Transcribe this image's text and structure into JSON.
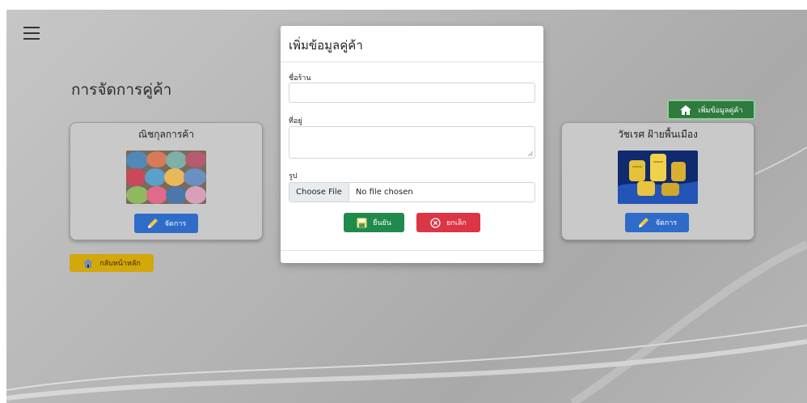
{
  "header": {
    "title": "การจัดการคู่ค้า"
  },
  "actions": {
    "add_partner_label": "เพิ่มข้อมูลคู่ค้า",
    "back_home_label": "กลับหน้าหลัก"
  },
  "partners": [
    {
      "name": "ณิชกุลการค้า",
      "manage_label": "จัดการ",
      "image_icon": "folded-towels-image"
    },
    {
      "name": "วัชเรศ ฝ้ายพื้นเมือง",
      "manage_label": "จัดการ",
      "image_icon": "thread-spools-image"
    }
  ],
  "modal": {
    "title": "เพิ่มข้อมูลคู่ค้า",
    "fields": {
      "shop_name": {
        "label": "ชื่อร้าน",
        "value": "",
        "placeholder": ""
      },
      "address": {
        "label": "ที่อยู่",
        "value": "",
        "placeholder": ""
      },
      "image": {
        "label": "รูป",
        "button_label": "Choose File",
        "status": "No file chosen"
      }
    },
    "confirm_label": "ยืนยัน",
    "cancel_label": "ยกเลิก"
  },
  "colors": {
    "add_button": "#2f7a3e",
    "manage_button": "#2f6cc9",
    "home_button": "#d4a70a",
    "confirm_button": "#1f8a4c",
    "cancel_button": "#dc3545"
  },
  "icons": [
    "menu-icon",
    "store-icon",
    "pencil-icon",
    "home-icon",
    "save-icon",
    "cancel-circle-icon"
  ]
}
